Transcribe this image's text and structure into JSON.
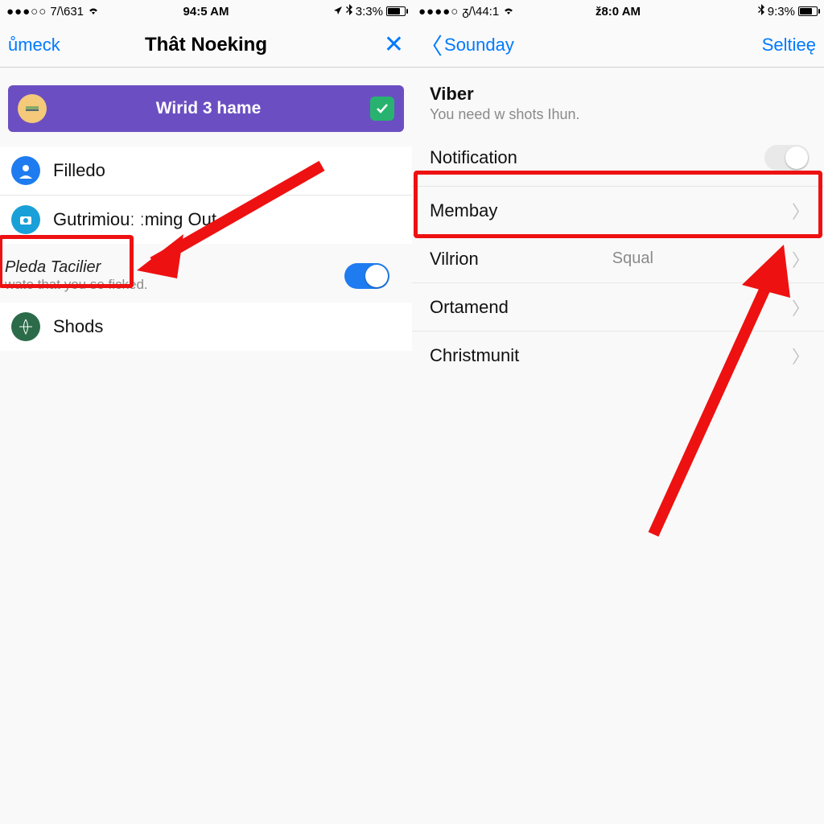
{
  "left": {
    "status": {
      "dots": "●●●○○",
      "carrier": "7/\\631",
      "wifi": "wifi-icon",
      "time": "94:5 AM",
      "loc": "nav-arrow",
      "bt": "bt",
      "battery_pct": "3:3%"
    },
    "nav": {
      "back": "ůmeck",
      "title": "Thât Noeking",
      "right": "×"
    },
    "banner": {
      "label": "Wirid 3 hame"
    },
    "rows": {
      "r0": {
        "label": "Filledo"
      },
      "r1": {
        "label": "Gutrimiouː   ːming Out"
      },
      "group_h": "Pleda Tacilier",
      "group_s": "wate that you se ficked.",
      "r2": {
        "label": "Shods"
      }
    }
  },
  "right": {
    "status": {
      "dots": "●●●●○",
      "carrier": "ᵹ/\\44:1",
      "wifi": "wifi-icon",
      "time": "ž8:0 AM",
      "battery_pct": "9:3%"
    },
    "nav": {
      "back": "Sounday",
      "title": "",
      "right": "Seltieę"
    },
    "section": {
      "title": "Viber",
      "desc": "You need w shots Ihun."
    },
    "rows": {
      "notif": {
        "label": "Notification"
      },
      "r1": {
        "label": "Membay"
      },
      "r2": {
        "label": "Vilrion",
        "value": "Squal"
      },
      "r3": {
        "label": "Ortamend"
      },
      "r4": {
        "label": "Christmunit"
      }
    }
  }
}
